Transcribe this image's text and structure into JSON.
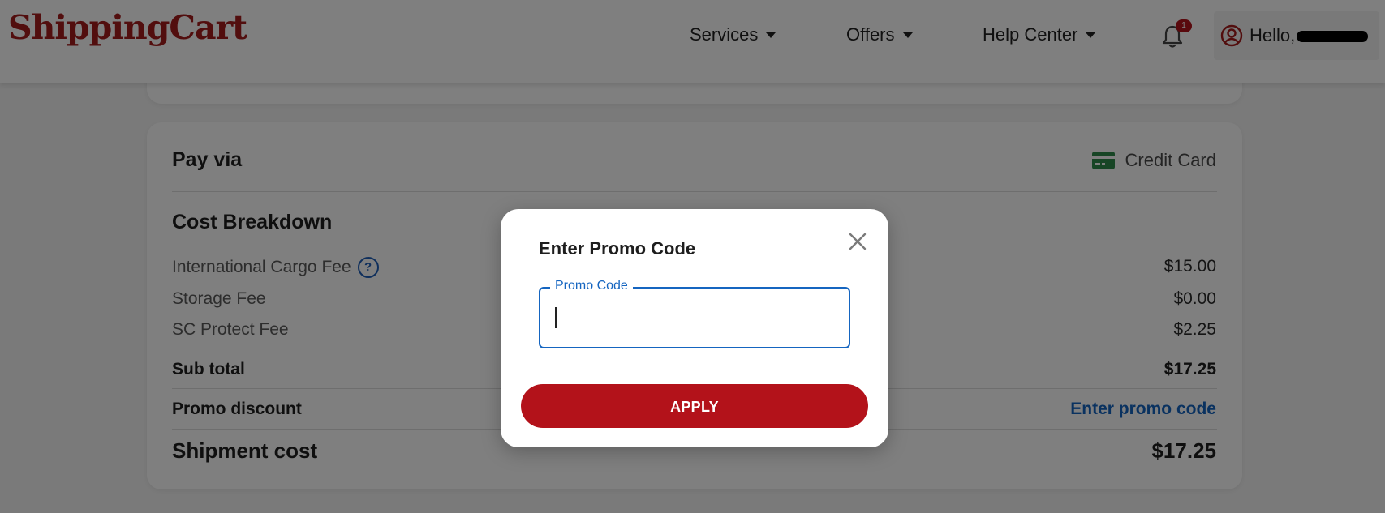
{
  "header": {
    "logo_text": "ShippingCart",
    "nav": [
      {
        "label": "Services"
      },
      {
        "label": "Offers"
      },
      {
        "label": "Help Center"
      }
    ],
    "notification_count": "1",
    "user_greeting": "Hello,",
    "brand_color": "#a51c1c"
  },
  "payment": {
    "pay_via_label": "Pay via",
    "method_label": "Credit Card",
    "method_icon": "credit-card-icon"
  },
  "cost_breakdown": {
    "title": "Cost Breakdown",
    "rows": [
      {
        "label": "International Cargo Fee",
        "value": "$15.00",
        "has_help": true
      },
      {
        "label": "Storage Fee",
        "value": "$0.00"
      },
      {
        "label": "SC Protect Fee",
        "value": "$2.25"
      }
    ],
    "subtotal": {
      "label": "Sub total",
      "value": "$17.25"
    },
    "promo": {
      "label": "Promo discount",
      "link": "Enter promo code"
    },
    "shipment": {
      "label": "Shipment cost",
      "value": "$17.25"
    }
  },
  "modal": {
    "title": "Enter Promo Code",
    "field_label": "Promo Code",
    "field_value": "",
    "apply_label": "APPLY",
    "accent_color": "#1565c0",
    "button_color": "#b3121a"
  }
}
